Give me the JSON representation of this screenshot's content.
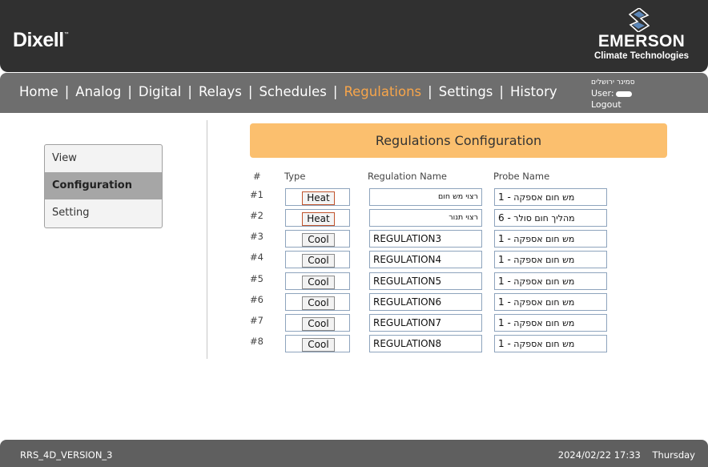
{
  "brand": {
    "dixell": "Dixell",
    "dixell_tm": "™",
    "emerson": "EMERSON",
    "emerson_sub": "Climate Technologies"
  },
  "nav": {
    "items": [
      "Home",
      "Analog",
      "Digital",
      "Relays",
      "Schedules",
      "Regulations",
      "Settings",
      "History"
    ],
    "active": "Regulations",
    "separator": "|"
  },
  "user": {
    "site": "סמינר ירושלים",
    "user_label": "User:",
    "logout": "Logout"
  },
  "sidebar": {
    "items": [
      "View",
      "Configuration",
      "Setting"
    ],
    "active": "Configuration"
  },
  "main": {
    "title": "Regulations Configuration",
    "columns": {
      "num": "#",
      "type": "Type",
      "name": "Regulation Name",
      "probe": "Probe Name"
    },
    "rows": [
      {
        "num": "#1",
        "type": "Heat",
        "name": "רצוי מש חום",
        "probe_num": "1 -",
        "probe_name": "מש חום אספקה"
      },
      {
        "num": "#2",
        "type": "Heat",
        "name": "רצוי תנור",
        "probe_num": "6 -",
        "probe_name": "מהליך חום סולר"
      },
      {
        "num": "#3",
        "type": "Cool",
        "name": "REGULATION3",
        "probe_num": "1 -",
        "probe_name": "מש חום אספקה"
      },
      {
        "num": "#4",
        "type": "Cool",
        "name": "REGULATION4",
        "probe_num": "1 -",
        "probe_name": "מש חום אספקה"
      },
      {
        "num": "#5",
        "type": "Cool",
        "name": "REGULATION5",
        "probe_num": "1 -",
        "probe_name": "מש חום אספקה"
      },
      {
        "num": "#6",
        "type": "Cool",
        "name": "REGULATION6",
        "probe_num": "1 -",
        "probe_name": "מש חום אספקה"
      },
      {
        "num": "#7",
        "type": "Cool",
        "name": "REGULATION7",
        "probe_num": "1 -",
        "probe_name": "מש חום אספקה"
      },
      {
        "num": "#8",
        "type": "Cool",
        "name": "REGULATION8",
        "probe_num": "1 -",
        "probe_name": "מש חום אספקה"
      }
    ]
  },
  "footer": {
    "version": "RRS_4D_VERSION_3",
    "datetime": "2024/02/22 17:33",
    "weekday": "Thursday"
  },
  "colors": {
    "accent": "#f7a54a",
    "title_bar": "#fbbf6e",
    "header_bg": "#303030",
    "nav_bg": "#6e6e6e",
    "heat_border": "#c0532c"
  }
}
